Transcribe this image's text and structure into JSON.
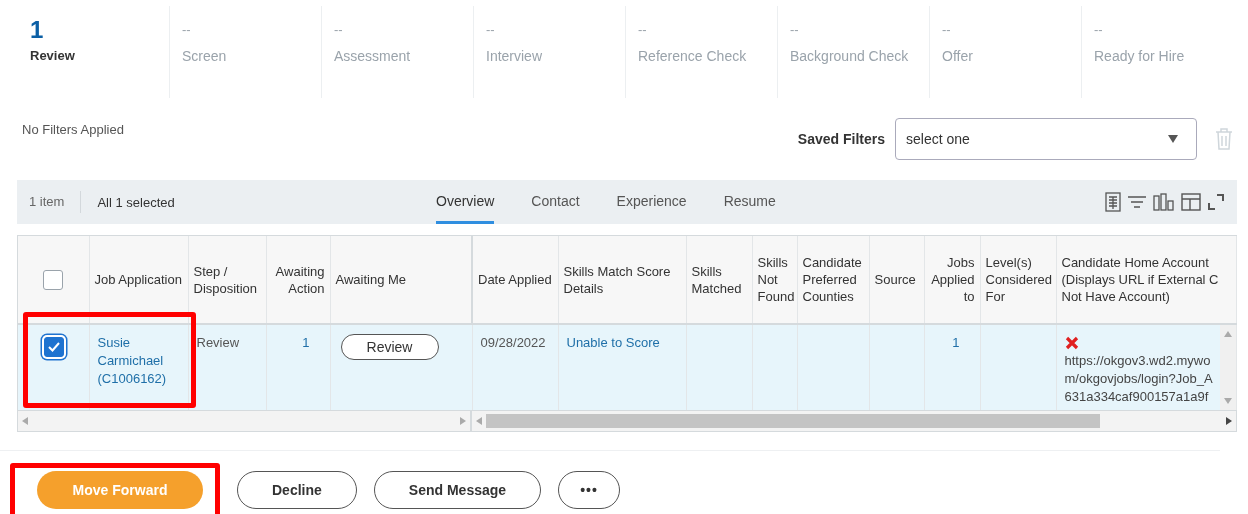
{
  "stages": [
    {
      "count": "1",
      "label": "Review",
      "selected": true
    },
    {
      "count": "--",
      "label": "Screen",
      "selected": false
    },
    {
      "count": "--",
      "label": "Assessment",
      "selected": false
    },
    {
      "count": "--",
      "label": "Interview",
      "selected": false
    },
    {
      "count": "--",
      "label": "Reference Check",
      "selected": false
    },
    {
      "count": "--",
      "label": "Background Check",
      "selected": false
    },
    {
      "count": "--",
      "label": "Offer",
      "selected": false
    },
    {
      "count": "--",
      "label": "Ready for Hire",
      "selected": false
    }
  ],
  "filters": {
    "status": "No Filters Applied",
    "saved_label": "Saved Filters",
    "saved_value": "select one"
  },
  "toolbar": {
    "count": "1 item",
    "selection": "All 1 selected",
    "tabs": [
      {
        "label": "Overview",
        "selected": true
      },
      {
        "label": "Contact",
        "selected": false
      },
      {
        "label": "Experience",
        "selected": false
      },
      {
        "label": "Resume",
        "selected": false
      }
    ]
  },
  "table": {
    "columns": [
      {
        "kind": "checkbox",
        "checked": false
      },
      {
        "label": "Job Application"
      },
      {
        "label": "Step / Disposition"
      },
      {
        "label": "Awaiting Action"
      },
      {
        "label": "Awaiting Me"
      },
      {
        "label": "Date Applied"
      },
      {
        "label": "Skills Match Score Details"
      },
      {
        "label": "Skills Matched"
      },
      {
        "label": "Skills Not Found"
      },
      {
        "label": "Candidate Preferred Counties"
      },
      {
        "label": "Source"
      },
      {
        "label": "Jobs Applied to"
      },
      {
        "label": "Level(s) Considered For"
      },
      {
        "label": "Candidate Home Account (Displays URL if External C Not Have Account)"
      }
    ],
    "rows": [
      {
        "selected": true,
        "cells": [
          {
            "kind": "checkbox"
          },
          {
            "kind": "link",
            "text": "Susie Carmichael (C1006162)"
          },
          {
            "kind": "text",
            "text": "Review"
          },
          {
            "kind": "number",
            "text": "1"
          },
          {
            "kind": "button",
            "text": "Review"
          },
          {
            "kind": "text",
            "text": "09/28/2022"
          },
          {
            "kind": "link",
            "text": "Unable to Score"
          },
          {
            "kind": "empty"
          },
          {
            "kind": "empty"
          },
          {
            "kind": "empty"
          },
          {
            "kind": "empty"
          },
          {
            "kind": "number",
            "text": "1"
          },
          {
            "kind": "empty"
          },
          {
            "kind": "account",
            "text": "https://okgov3.wd2.mywo\nm/okgovjobs/login?Job_A\n631a334caf900157a1a9f"
          }
        ]
      }
    ]
  },
  "actions": [
    {
      "label": "Move Forward",
      "kind": "primary"
    },
    {
      "label": "Decline",
      "kind": "secondary"
    },
    {
      "label": "Send Message",
      "kind": "secondary"
    },
    {
      "label": "•••",
      "kind": "more"
    }
  ]
}
